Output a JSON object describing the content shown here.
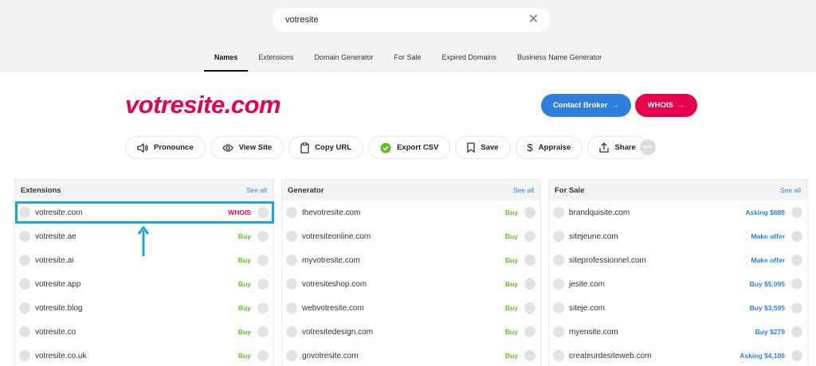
{
  "search": {
    "query": "votresite"
  },
  "tabs": [
    {
      "label": "Names",
      "active": true
    },
    {
      "label": "Extensions"
    },
    {
      "label": "Domain Generator"
    },
    {
      "label": "For Sale"
    },
    {
      "label": "Expired Domains"
    },
    {
      "label": "Business Name Generator"
    }
  ],
  "domain": {
    "name": "votresite.com"
  },
  "header_buttons": {
    "broker": "Contact Broker",
    "whois": "WHOIS"
  },
  "actions": [
    {
      "label": "Pronounce",
      "icon": "speaker-icon"
    },
    {
      "label": "View Site",
      "icon": "eye-icon"
    },
    {
      "label": "Copy URL",
      "icon": "clipboard-icon"
    },
    {
      "label": "Export CSV",
      "icon": "check-badge-icon"
    },
    {
      "label": "Save",
      "icon": "bookmark-icon"
    },
    {
      "label": "Appraise",
      "icon": "dollar-icon"
    },
    {
      "label": "Share",
      "icon": "share-icon"
    }
  ],
  "panels": {
    "extensions": {
      "title": "Extensions",
      "see_all": "See all",
      "rows": [
        {
          "name": "votresite.com",
          "status": "WHOIS"
        },
        {
          "name": "votresite.ae",
          "status": "Buy"
        },
        {
          "name": "votresite.ai",
          "status": "Buy"
        },
        {
          "name": "votresite.app",
          "status": "Buy"
        },
        {
          "name": "votresite.blog",
          "status": "Buy"
        },
        {
          "name": "votresite.co",
          "status": "Buy"
        },
        {
          "name": "votresite.co.uk",
          "status": "Buy"
        }
      ]
    },
    "generator": {
      "title": "Generator",
      "see_all": "See all",
      "rows": [
        {
          "name": "thevotresite.com",
          "status": "Buy"
        },
        {
          "name": "votresiteonline.com",
          "status": "Buy"
        },
        {
          "name": "myvotresite.com",
          "status": "Buy"
        },
        {
          "name": "votresiteshop.com",
          "status": "Buy"
        },
        {
          "name": "webvotresite.com",
          "status": "Buy"
        },
        {
          "name": "votresitedesign.com",
          "status": "Buy"
        },
        {
          "name": "govotresite.com",
          "status": "Buy"
        }
      ]
    },
    "for_sale": {
      "title": "For Sale",
      "see_all": "See all",
      "rows": [
        {
          "name": "brandquisite.com",
          "status": "Asking $688"
        },
        {
          "name": "sitejeune.com",
          "status": "Make offer"
        },
        {
          "name": "siteprofessionnel.com",
          "status": "Make offer"
        },
        {
          "name": "jesite.com",
          "status": "Buy $5,095"
        },
        {
          "name": "siteje.com",
          "status": "Buy $3,595"
        },
        {
          "name": "myensite.com",
          "status": "Buy $279"
        },
        {
          "name": "createurdesiteweb.com",
          "status": "Asking $4,106"
        }
      ]
    }
  },
  "colors": {
    "brand": "#e8004c",
    "accent": "#2e80dc",
    "buy": "#5fbf2a",
    "highlight": "#18a8e0"
  }
}
